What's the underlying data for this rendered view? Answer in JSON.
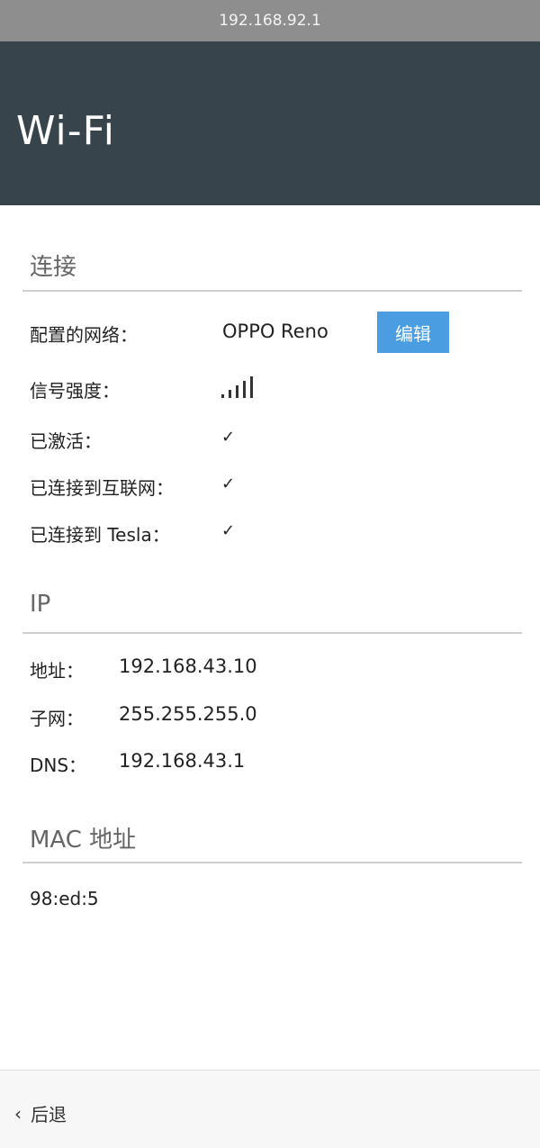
{
  "browser": {
    "url": "192.168.92.1"
  },
  "header": {
    "title": "Wi-Fi"
  },
  "connection": {
    "title": "连接",
    "configured_network_label": "配置的网络：",
    "configured_network_value": "OPPO Reno",
    "edit_label": "编辑",
    "signal_label": "信号强度：",
    "signal_icon": "signal-strength-icon",
    "activated_label": "已激活：",
    "activated_value": "✓",
    "internet_label": "已连接到互联网：",
    "internet_value": "✓",
    "tesla_label": "已连接到 Tesla：",
    "tesla_value": "✓"
  },
  "ip": {
    "title": "IP",
    "address_label": "地址：",
    "address_value": "192.168.43.10",
    "subnet_label": "子网：",
    "subnet_value": "255.255.255.0",
    "dns_label": "DNS：",
    "dns_value": "192.168.43.1"
  },
  "mac": {
    "title": "MAC 地址",
    "value": "98:ed:5"
  },
  "footer": {
    "back_label": "后退",
    "back_icon": "chevron-left-icon"
  }
}
